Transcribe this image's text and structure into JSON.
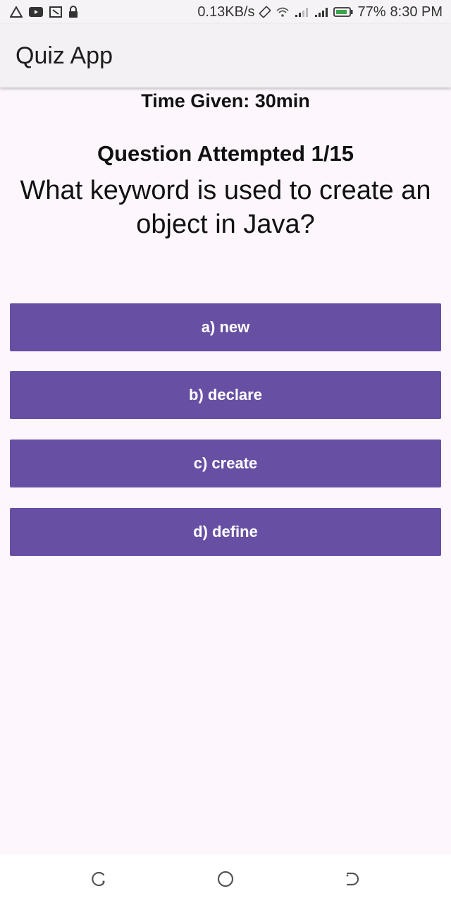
{
  "status_bar": {
    "network_speed": "0.13KB/s",
    "battery_percent": "77%",
    "time": "8:30 PM",
    "icons": [
      "alert-icon",
      "youtube-icon",
      "screenshot-icon",
      "lock-icon",
      "rotation-icon",
      "wifi-icon",
      "signal-icon",
      "signal-icon",
      "battery-icon"
    ]
  },
  "app_bar": {
    "title": "Quiz App"
  },
  "quiz": {
    "time_given": "Time Given: 30min",
    "attempted": "Question Attempted 1/15",
    "question": "What keyword is used to create an object in Java?",
    "options": [
      {
        "label": "a) new"
      },
      {
        "label": "b) declare"
      },
      {
        "label": "c) create"
      },
      {
        "label": "d) define"
      }
    ]
  },
  "colors": {
    "option_bg": "#6750a4",
    "page_bg": "#fdf7fd"
  },
  "nav_bar": {
    "icons": [
      "recent-apps-icon",
      "home-icon",
      "back-icon"
    ]
  }
}
